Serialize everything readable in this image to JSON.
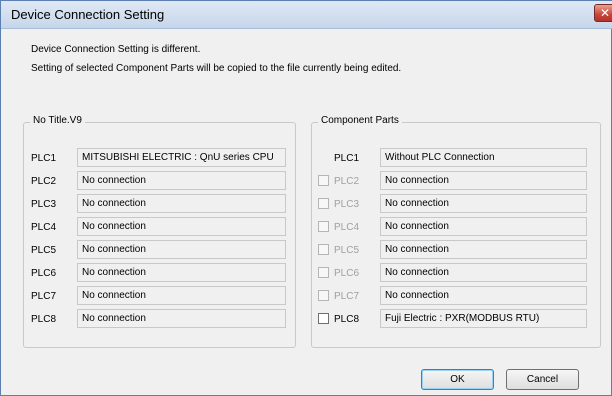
{
  "window": {
    "title": "Device Connection Setting",
    "close_label": "✕"
  },
  "message": {
    "line1": "Device Connection Setting is different.",
    "line2": "Setting of selected Component Parts will be copied to the file currently being edited."
  },
  "left_group": {
    "title": "No Title.V9",
    "rows": [
      {
        "label": "PLC1",
        "value": "MITSUBISHI ELECTRIC : QnU series CPU"
      },
      {
        "label": "PLC2",
        "value": "No connection"
      },
      {
        "label": "PLC3",
        "value": "No connection"
      },
      {
        "label": "PLC4",
        "value": "No connection"
      },
      {
        "label": "PLC5",
        "value": "No connection"
      },
      {
        "label": "PLC6",
        "value": "No connection"
      },
      {
        "label": "PLC7",
        "value": "No connection"
      },
      {
        "label": "PLC8",
        "value": "No connection"
      }
    ]
  },
  "right_group": {
    "title": "Component Parts",
    "rows": [
      {
        "label": "PLC1",
        "value": "Without PLC Connection"
      },
      {
        "label": "PLC2",
        "value": "No connection",
        "checked": false
      },
      {
        "label": "PLC3",
        "value": "No connection",
        "checked": false
      },
      {
        "label": "PLC4",
        "value": "No connection",
        "checked": false
      },
      {
        "label": "PLC5",
        "value": "No connection",
        "checked": false
      },
      {
        "label": "PLC6",
        "value": "No connection",
        "checked": false
      },
      {
        "label": "PLC7",
        "value": "No connection",
        "checked": false
      },
      {
        "label": "PLC8",
        "value": "Fuji Electric : PXR(MODBUS RTU)",
        "checked": false
      }
    ]
  },
  "buttons": {
    "ok": "OK",
    "cancel": "Cancel"
  }
}
